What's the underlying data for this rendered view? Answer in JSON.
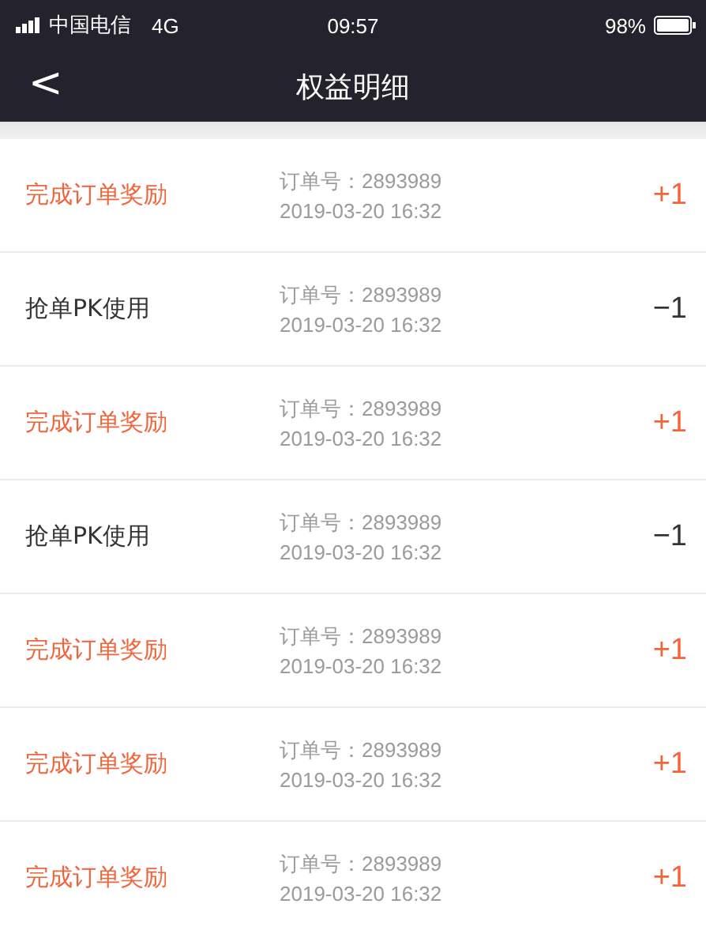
{
  "status_bar": {
    "carrier": "中国电信",
    "network": "4G",
    "time": "09:57",
    "battery": "98%"
  },
  "nav": {
    "back": "<",
    "title": "权益明细"
  },
  "records": [
    {
      "kind": "reward",
      "label": "完成订单奖励",
      "order": "订单号：2893989",
      "datetime": "2019-03-20  16:32",
      "amount": "+1"
    },
    {
      "kind": "use",
      "label": "抢单PK使用",
      "order": "订单号：2893989",
      "datetime": "2019-03-20  16:32",
      "amount": "−1"
    },
    {
      "kind": "reward",
      "label": "完成订单奖励",
      "order": "订单号：2893989",
      "datetime": "2019-03-20  16:32",
      "amount": "+1"
    },
    {
      "kind": "use",
      "label": "抢单PK使用",
      "order": "订单号：2893989",
      "datetime": "2019-03-20  16:32",
      "amount": "−1"
    },
    {
      "kind": "reward",
      "label": "完成订单奖励",
      "order": "订单号：2893989",
      "datetime": "2019-03-20  16:32",
      "amount": "+1"
    },
    {
      "kind": "reward",
      "label": "完成订单奖励",
      "order": "订单号：2893989",
      "datetime": "2019-03-20  16:32",
      "amount": "+1"
    },
    {
      "kind": "reward",
      "label": "完成订单奖励",
      "order": "订单号：2893989",
      "datetime": "2019-03-20  16:32",
      "amount": "+1"
    }
  ]
}
